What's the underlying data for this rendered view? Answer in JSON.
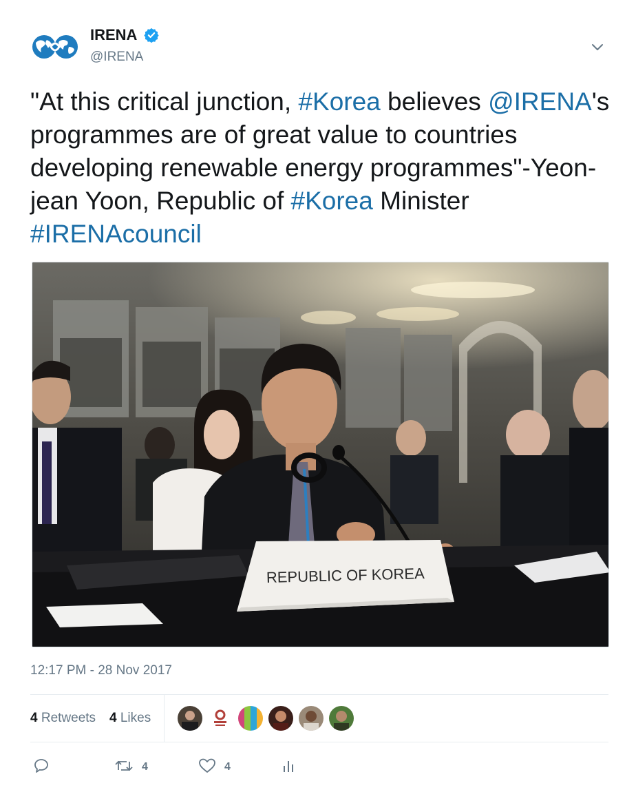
{
  "user": {
    "display_name": "IRENA",
    "handle": "@IRENA",
    "verified": true
  },
  "icons": {
    "avatar": "irena-logo-icon",
    "verified": "verified-badge-icon",
    "menu": "chevron-down-icon",
    "reply": "reply-icon",
    "retweet": "retweet-icon",
    "like": "heart-icon",
    "analytics": "analytics-icon"
  },
  "tweet": {
    "segments": [
      {
        "text": "\"At this critical junction, ",
        "type": "text"
      },
      {
        "text": "#Korea",
        "type": "hashtag"
      },
      {
        "text": " believes ",
        "type": "text"
      },
      {
        "text": "@IRENA",
        "type": "mention"
      },
      {
        "text": "'s programmes are of great value to countries developing renewable energy programmes\"-Yeon-jean Yoon, Republic of ",
        "type": "text"
      },
      {
        "text": "#Korea",
        "type": "hashtag"
      },
      {
        "text": " Minister ",
        "type": "text"
      },
      {
        "text": "#IRENAcouncil",
        "type": "hashtag"
      }
    ]
  },
  "media": {
    "placard_text": "REPUBLIC OF KOREA"
  },
  "timestamp": "12:17 PM - 28 Nov 2017",
  "stats": {
    "retweets_count": "4",
    "retweets_label": "Retweets",
    "likes_count": "4",
    "likes_label": "Likes"
  },
  "liker_avatars": 6,
  "actions": {
    "retweet_count": "4",
    "like_count": "4"
  },
  "colors": {
    "link": "#1b6ea7",
    "verified": "#1da1f2",
    "muted": "#657786",
    "logo": "#1f7cbf"
  }
}
